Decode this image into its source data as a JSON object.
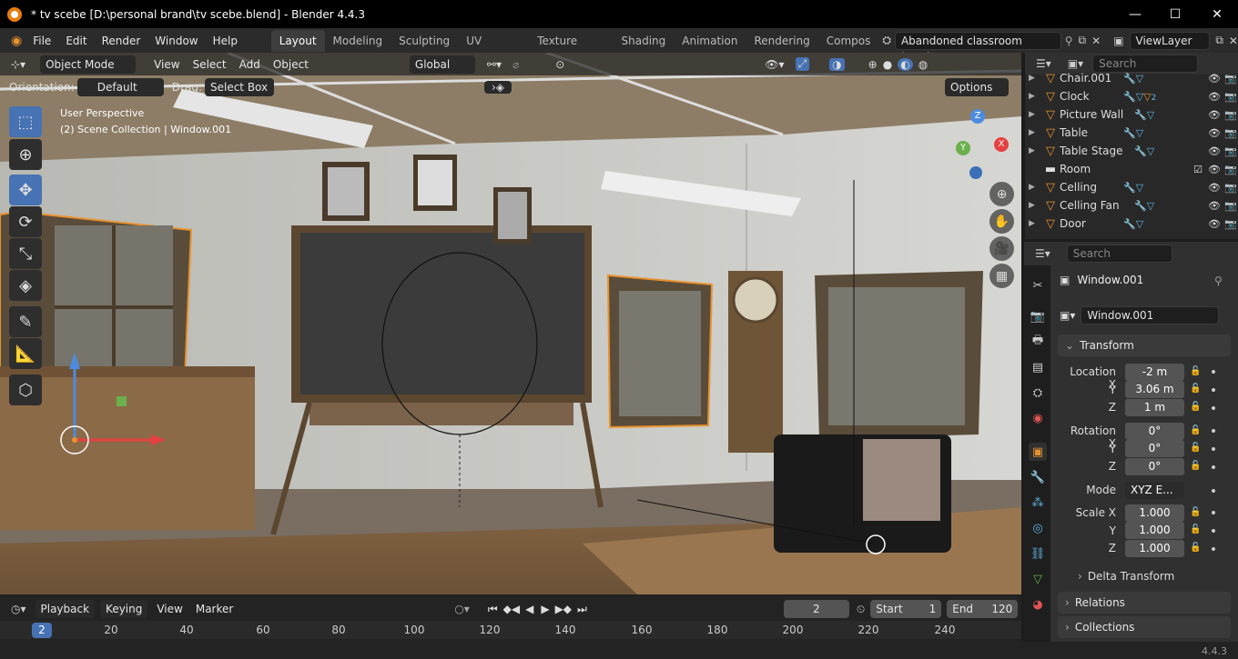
{
  "window": {
    "title": "* tv scebe [D:\\personal brand\\tv scebe.blend] - Blender 4.4.3",
    "min": "—",
    "max": "☐",
    "close": "✕"
  },
  "menu": [
    "File",
    "Edit",
    "Render",
    "Window",
    "Help"
  ],
  "workspaces": [
    "Layout",
    "Modeling",
    "Sculpting",
    "UV Editing",
    "Texture Paint",
    "Shading",
    "Animation",
    "Rendering",
    "Compos"
  ],
  "scene": {
    "name": "Abandoned classroom interior",
    "view_layer": "ViewLayer"
  },
  "viewport_header": {
    "mode": "Object Mode",
    "menus": [
      "View",
      "Select",
      "Add",
      "Object"
    ],
    "transform_orientation": "Global"
  },
  "tool_settings": {
    "orientation_label": "Orientation:",
    "orientation_value": "Default",
    "drag_label": "Drag:",
    "drag_value": "Select Box",
    "options": "Options"
  },
  "viewport": {
    "perspective": "User Perspective",
    "collection_info": "(2) Scene Collection | Window.001"
  },
  "gizmo": {
    "x": "X",
    "y": "Y",
    "z": "Z"
  },
  "outliner": {
    "search_placeholder": "Search",
    "rows": [
      {
        "name": "Chair.001",
        "type": "object"
      },
      {
        "name": "Clock",
        "type": "object",
        "badge": "2"
      },
      {
        "name": "Picture Wall",
        "type": "object"
      },
      {
        "name": "Table",
        "type": "object"
      },
      {
        "name": "Table Stage",
        "type": "object"
      },
      {
        "name": "Room",
        "type": "collection"
      },
      {
        "name": "Celling",
        "type": "object"
      },
      {
        "name": "Celling Fan",
        "type": "object"
      },
      {
        "name": "Door",
        "type": "object"
      }
    ]
  },
  "properties": {
    "search_placeholder": "Search",
    "object_name": "Window.001",
    "data_name": "Window.001",
    "transform_label": "Transform",
    "location": {
      "label": "Location X",
      "x": "-2 m",
      "y": "3.06 m",
      "z": "1 m"
    },
    "rotation": {
      "label": "Rotation X",
      "x": "0°",
      "y": "0°",
      "z": "0°"
    },
    "mode_label": "Mode",
    "mode_value": "XYZ E...",
    "scale": {
      "label": "Scale X",
      "x": "1.000",
      "y": "1.000",
      "z": "1.000"
    },
    "axis_y": "Y",
    "axis_z": "Z",
    "delta": "Delta Transform",
    "relations": "Relations",
    "collections": "Collections"
  },
  "timeline": {
    "menus": [
      "Playback",
      "Keying",
      "View",
      "Marker"
    ],
    "current_frame": "2",
    "start_label": "Start",
    "start": "1",
    "end_label": "End",
    "end": "120",
    "playhead": "2",
    "ticks": [
      "20",
      "40",
      "60",
      "80",
      "100",
      "120",
      "140",
      "160",
      "180",
      "200",
      "220",
      "240"
    ]
  },
  "status": {
    "version": "4.4.3"
  },
  "colors": {
    "accent": "#4772b3",
    "selection": "#e8922e",
    "bg": "#1d1d1d"
  }
}
